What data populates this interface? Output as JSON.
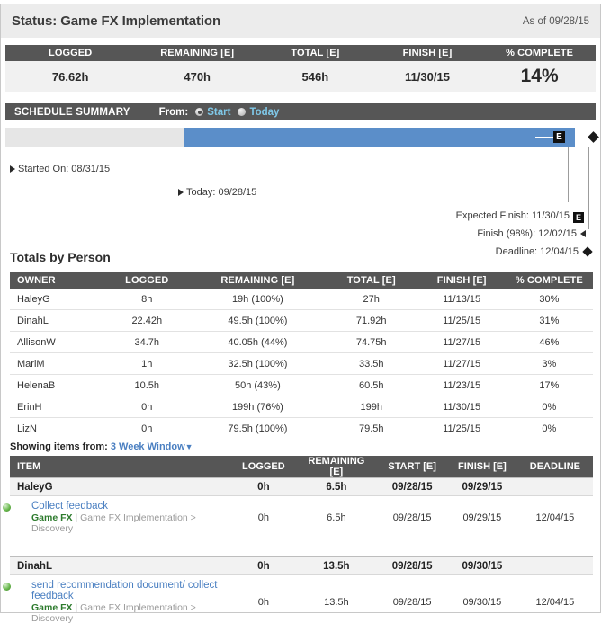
{
  "header": {
    "title": "Status: Game FX Implementation",
    "as_of": "As of 09/28/15"
  },
  "summary": {
    "columns": [
      "LOGGED",
      "REMAINING [E]",
      "TOTAL [E]",
      "FINISH [E]",
      "% COMPLETE"
    ],
    "values": [
      "76.62h",
      "470h",
      "546h",
      "11/30/15",
      "14%"
    ]
  },
  "schedule": {
    "label": "SCHEDULE SUMMARY",
    "from_label": "From:",
    "option_start": "Start",
    "option_today": "Today",
    "selected": "Start",
    "bar": {
      "fill_color": "#5b8ec9",
      "track_color": "#e6e6e6",
      "percent_elapsed": 31
    },
    "markers": {
      "started_on": "Started On: 08/31/15",
      "today": "Today: 09/28/15",
      "expected_finish": "Expected Finish: 11/30/15",
      "finish_probable": "Finish (98%): 12/02/15",
      "deadline": "Deadline: 12/04/15",
      "expected_badge": "E"
    }
  },
  "totals": {
    "section_title": "Totals by Person",
    "columns": [
      "OWNER",
      "LOGGED",
      "REMAINING [E]",
      "TOTAL [E]",
      "FINISH [E]",
      "% COMPLETE"
    ],
    "rows": [
      [
        "HaleyG",
        "8h",
        "19h (100%)",
        "27h",
        "11/13/15",
        "30%"
      ],
      [
        "DinahL",
        "22.42h",
        "49.5h (100%)",
        "71.92h",
        "11/25/15",
        "31%"
      ],
      [
        "AllisonW",
        "34.7h",
        "40.05h (44%)",
        "74.75h",
        "11/27/15",
        "46%"
      ],
      [
        "MariM",
        "1h",
        "32.5h (100%)",
        "33.5h",
        "11/27/15",
        "3%"
      ],
      [
        "HelenaB",
        "10.5h",
        "50h (43%)",
        "60.5h",
        "11/23/15",
        "17%"
      ],
      [
        "ErinH",
        "0h",
        "199h (76%)",
        "199h",
        "11/30/15",
        "0%"
      ],
      [
        "LizN",
        "0h",
        "79.5h (100%)",
        "79.5h",
        "11/25/15",
        "0%"
      ]
    ]
  },
  "showing": {
    "prefix": "Showing items from:",
    "value": "3 Week Window",
    "caret": "▼"
  },
  "items": {
    "columns": [
      "ITEM",
      "LOGGED",
      "REMAINING [E]",
      "START [E]",
      "FINISH [E]",
      "DEADLINE"
    ],
    "groups": [
      {
        "owner": "HaleyG",
        "owner_logged": "0h",
        "owner_remaining": "6.5h",
        "owner_start": "09/28/15",
        "owner_finish": "09/29/15",
        "owner_deadline": "",
        "tasks": [
          {
            "name": "Collect feedback",
            "project": "Game FX",
            "separator": "|",
            "path": "Game FX Implementation  >  Discovery",
            "logged": "0h",
            "remaining": "6.5h",
            "start": "09/28/15",
            "finish": "09/29/15",
            "deadline": "12/04/15"
          }
        ]
      },
      {
        "owner": "DinahL",
        "owner_logged": "0h",
        "owner_remaining": "13.5h",
        "owner_start": "09/28/15",
        "owner_finish": "09/30/15",
        "owner_deadline": "",
        "tasks": [
          {
            "name": "send recommendation document/ collect feedback",
            "project": "Game FX",
            "separator": "|",
            "path": "Game FX Implementation  >  Discovery",
            "logged": "0h",
            "remaining": "13.5h",
            "start": "09/28/15",
            "finish": "09/30/15",
            "deadline": "12/04/15"
          }
        ]
      }
    ]
  }
}
